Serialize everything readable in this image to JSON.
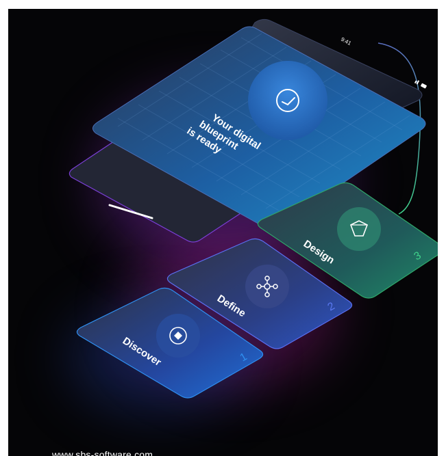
{
  "phone": {
    "time": "9:41"
  },
  "main_card": {
    "text_lines": [
      "Your digital",
      "blueprint",
      "is ready"
    ],
    "icon": "clock-icon"
  },
  "steps": [
    {
      "label": "Discover",
      "number": "1",
      "icon": "compass-icon"
    },
    {
      "label": "Define",
      "number": "2",
      "icon": "network-nodes-icon"
    },
    {
      "label": "Design",
      "number": "3",
      "icon": "gem-icon"
    }
  ],
  "colors": {
    "background": "#050507",
    "accent_blue": "#2a6fd6",
    "accent_purple": "#7b3fd6",
    "accent_green": "#2fa86a",
    "glow_magenta": "#a0249a"
  },
  "footer": {
    "url": "www.sbs-software.com"
  }
}
